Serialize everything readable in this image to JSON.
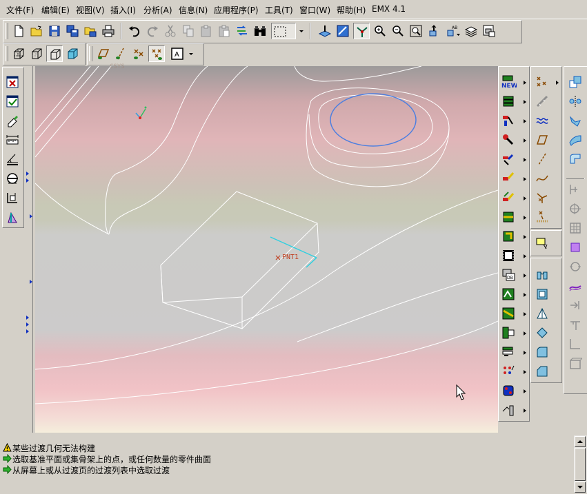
{
  "menubar": {
    "items": [
      {
        "label": "文件(F)"
      },
      {
        "label": "编辑(E)"
      },
      {
        "label": "视图(V)"
      },
      {
        "label": "插入(I)"
      },
      {
        "label": "分析(A)"
      },
      {
        "label": "信息(N)"
      },
      {
        "label": "应用程序(P)"
      },
      {
        "label": "工具(T)"
      },
      {
        "label": "窗口(W)"
      },
      {
        "label": "帮助(H)"
      },
      {
        "label": "EMX 4.1"
      }
    ]
  },
  "viewport": {
    "point_label": "PNT1",
    "datum_label": "CSYS"
  },
  "messages": [
    {
      "icon": "warning-icon",
      "text": "某些过渡几何无法构建"
    },
    {
      "icon": "prompt-arrow-icon",
      "text": "选取基准平面或集骨架上的点，或任何数量的零件曲面"
    },
    {
      "icon": "prompt-arrow-icon",
      "text": "从屏幕上或从过渡页的过渡列表中选取过渡"
    }
  ],
  "colors": {
    "chrome": "#d4d0c8",
    "geometry_edge": "#ffffff",
    "selected_curve": "#4d7fe0",
    "datum_cyan": "#30d0e0",
    "point_color": "#c04020"
  }
}
